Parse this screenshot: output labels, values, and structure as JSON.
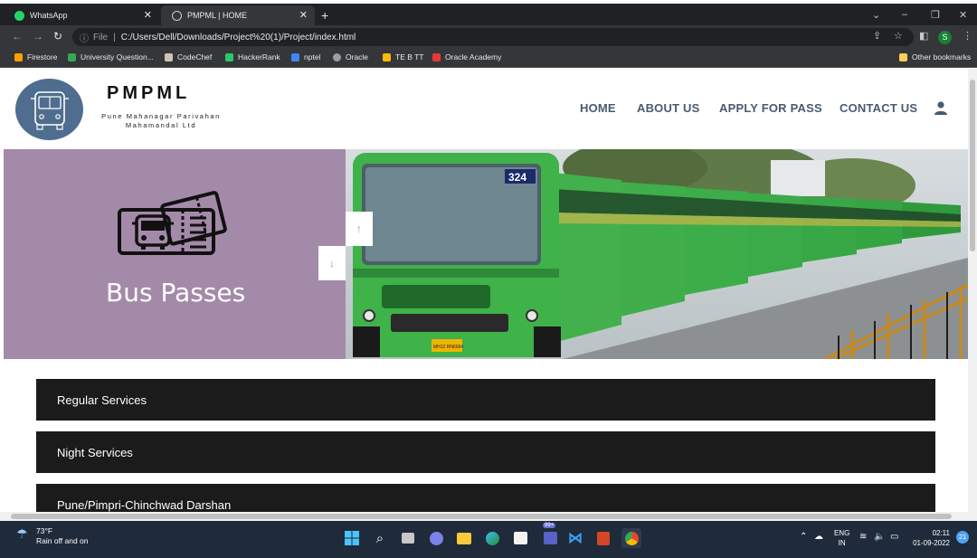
{
  "browser": {
    "tabs": [
      {
        "title": "WhatsApp",
        "favicon": "whatsapp-icon",
        "active": false
      },
      {
        "title": "PMPML | HOME",
        "favicon": "globe-icon",
        "active": true
      }
    ],
    "address": {
      "file_label": "File",
      "url": "C:/Users/Dell/Downloads/Project%20(1)/Project/index.html"
    },
    "profile_initial": "S",
    "bookmarks": [
      {
        "label": "Firestore",
        "icon": "firestore-icon",
        "color": "#ffa000"
      },
      {
        "label": "University Question...",
        "icon": "drive-icon",
        "color": "#34a853"
      },
      {
        "label": "CodeChef",
        "icon": "codechef-icon",
        "color": "#d0c5b0"
      },
      {
        "label": "HackerRank",
        "icon": "hackerrank-icon",
        "color": "#2ec866"
      },
      {
        "label": "nptel",
        "icon": "nptel-icon",
        "color": "#4285f4"
      },
      {
        "label": "Oracle",
        "icon": "globe-icon",
        "color": "#9aa0a6"
      },
      {
        "label": "TE B TT",
        "icon": "drive-icon",
        "color": "#fbbc04"
      },
      {
        "label": "Oracle Academy",
        "icon": "oracle-icon",
        "color": "#e53935"
      }
    ],
    "other_bookmarks": "Other bookmarks"
  },
  "site": {
    "brand_title": "PMPML",
    "brand_subtitle": "Pune Mahanagar Parivahan Mahamandal Ltd",
    "nav": [
      "HOME",
      "ABOUT US",
      "APPLY FOR PASS",
      "CONTACT US"
    ],
    "hero_title": "Bus Passes",
    "bus_route_number": "324",
    "bus_number_plate": "MH12 RN6064",
    "accordion": [
      "Regular Services",
      "Night Services",
      "Pune/Pimpri-Chinchwad Darshan"
    ]
  },
  "taskbar": {
    "temperature": "73°F",
    "weather_text": "Rain off and on",
    "language_top": "ENG",
    "language_bottom": "IN",
    "time": "02:11",
    "date": "01-09-2022",
    "notification_count": "21",
    "teams_badge": "99+"
  },
  "colors": {
    "nav_text": "#4a5a70",
    "hero_left_bg": "#a48aa9",
    "accordion_bg": "#1b1b1b",
    "bus_green": "#3aa84a"
  }
}
